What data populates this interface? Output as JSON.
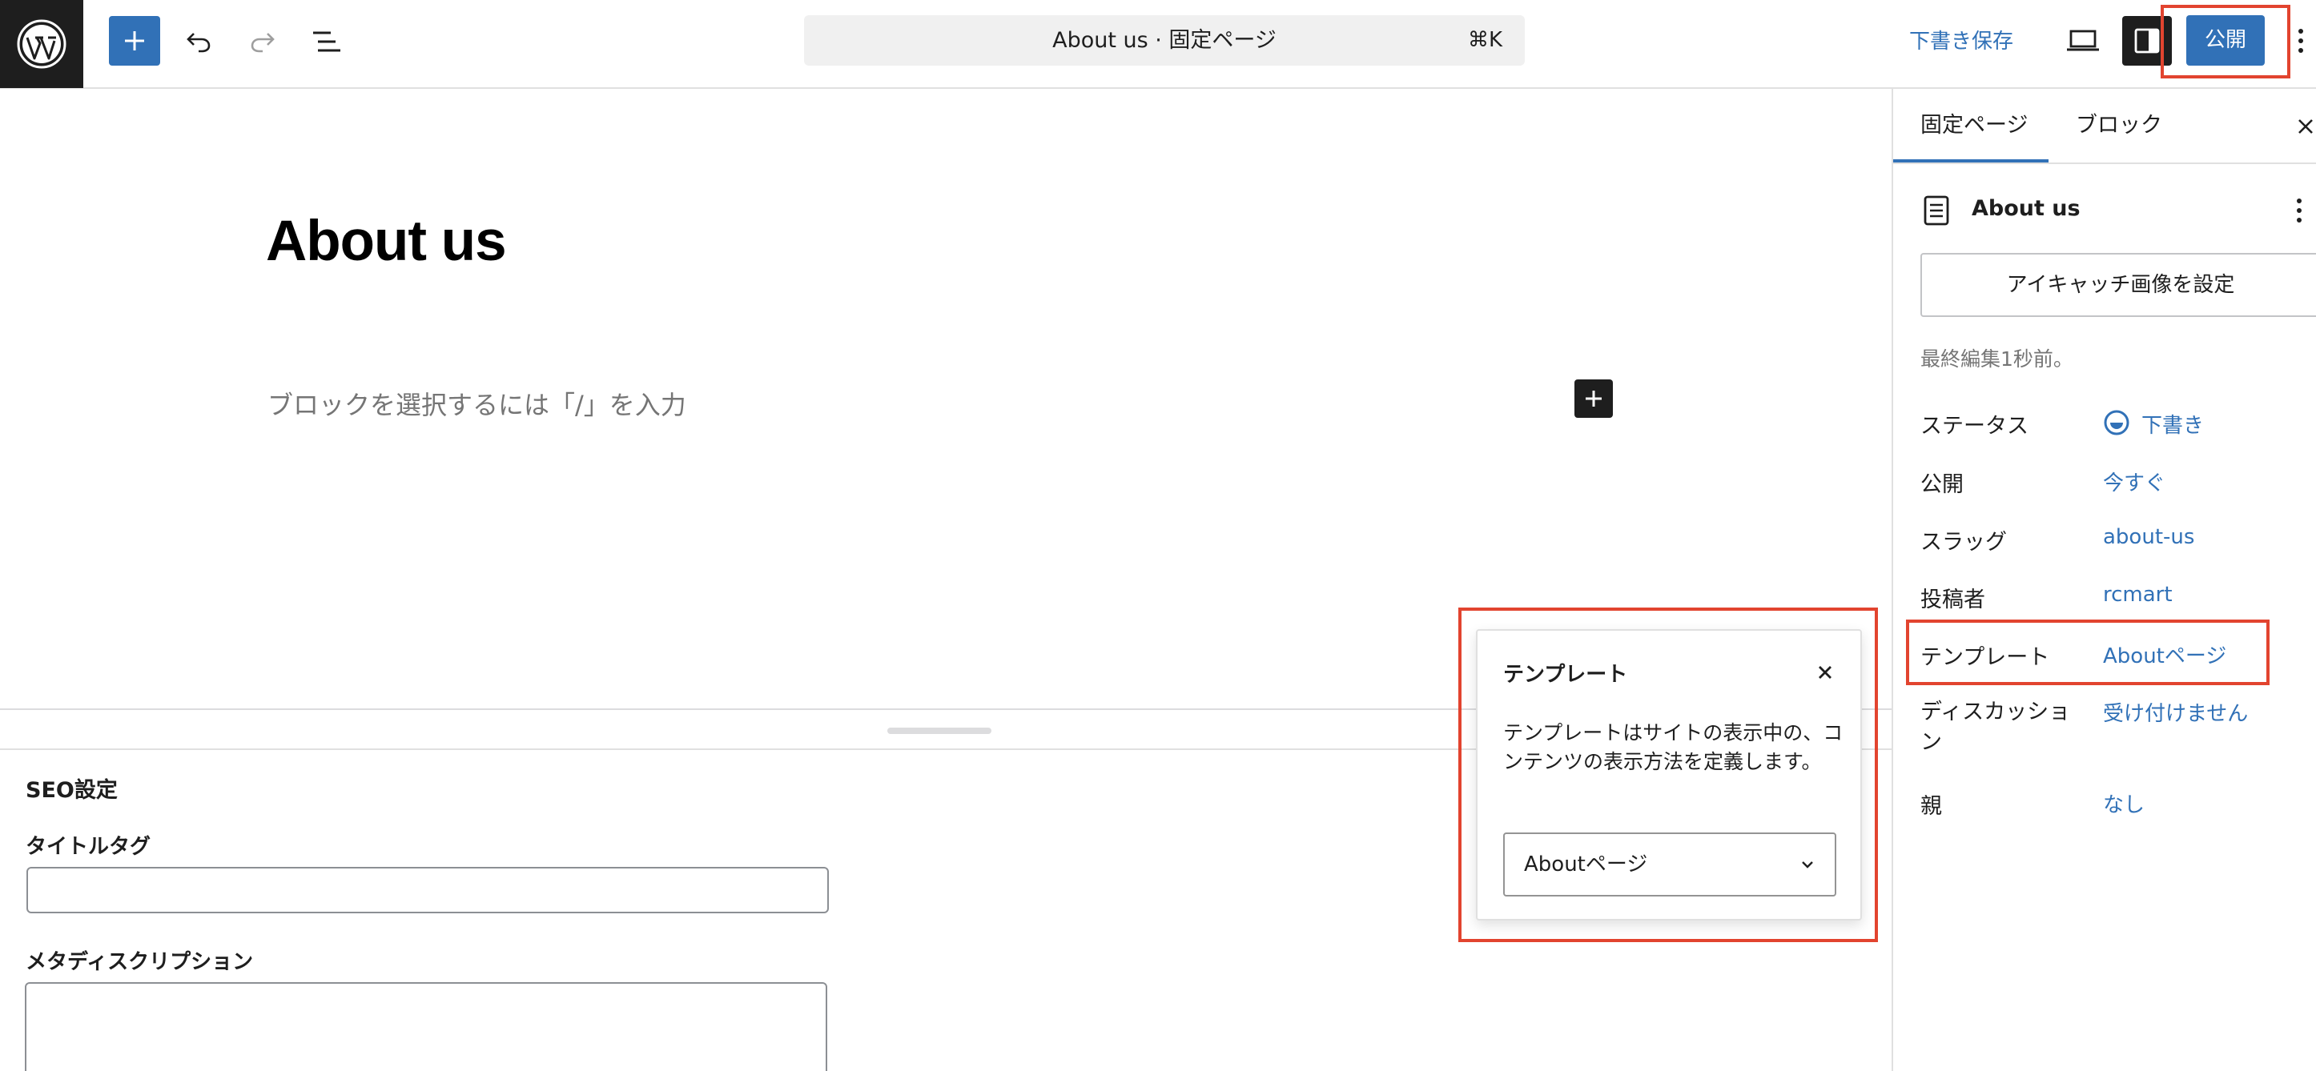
{
  "toolbar": {
    "document_title": "About us · 固定ページ",
    "command_shortcut": "⌘K",
    "save_draft_label": "下書き保存",
    "publish_label": "公開"
  },
  "editor": {
    "post_title": "About us",
    "block_placeholder": "ブロックを選択するには「/」を入力"
  },
  "meta_box": {
    "title": "SEO設定",
    "title_tag_label": "タイトルタグ",
    "title_tag_value": "",
    "meta_description_label": "メタディスクリプション",
    "meta_description_value": ""
  },
  "template_popover": {
    "title": "テンプレート",
    "description": "テンプレートはサイトの表示中の、コンテンツの表示方法を定義します。",
    "selected_template": "Aboutページ"
  },
  "sidebar": {
    "tabs": [
      {
        "label": "固定ページ",
        "active": true
      },
      {
        "label": "ブロック",
        "active": false
      }
    ],
    "summary_title": "About us",
    "featured_image_button": "アイキャッチ画像を設定",
    "last_edited": "最終編集1秒前。",
    "rows": [
      {
        "label": "ステータス",
        "value": "下書き"
      },
      {
        "label": "公開",
        "value": "今すぐ"
      },
      {
        "label": "スラッグ",
        "value": "about-us"
      },
      {
        "label": "投稿者",
        "value": "rcmart"
      },
      {
        "label": "テンプレート",
        "value": "Aboutページ"
      },
      {
        "label": "ディスカッション",
        "value": "受け付けません"
      },
      {
        "label": "親",
        "value": "なし"
      }
    ]
  },
  "colors": {
    "accent": "#3171b7",
    "highlight": "#e2442f",
    "dark": "#1e1e1e"
  },
  "icons": [
    "wordpress-logo-icon",
    "plus-icon",
    "undo-icon",
    "redo-icon",
    "list-view-icon",
    "preview-icon",
    "sidebar-toggle-icon",
    "more-vertical-icon",
    "close-icon",
    "page-icon",
    "draft-status-icon",
    "chevron-down-icon"
  ]
}
